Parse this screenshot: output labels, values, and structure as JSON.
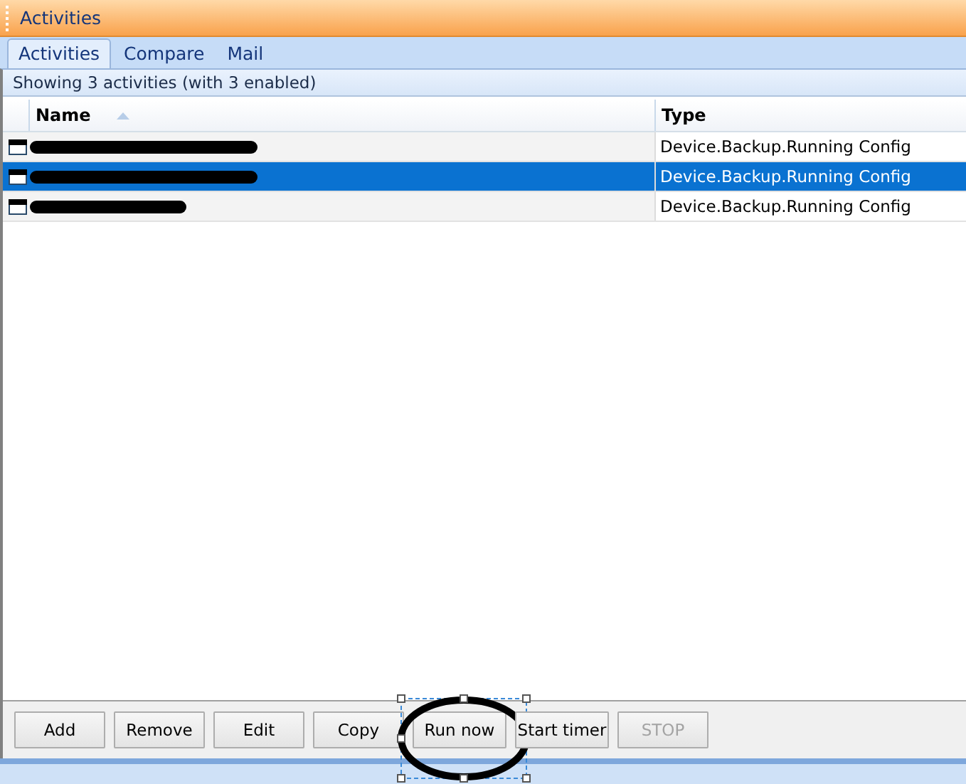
{
  "window": {
    "title": "Activities"
  },
  "tabs": [
    {
      "label": "Activities",
      "selected": true
    },
    {
      "label": "Compare",
      "selected": false
    },
    {
      "label": "Mail",
      "selected": false
    }
  ],
  "summary": "Showing 3 activities (with 3 enabled)",
  "table": {
    "columns": [
      {
        "label": "Name",
        "sorted": true
      },
      {
        "label": "Type",
        "sorted": false
      }
    ],
    "rows": [
      {
        "selected": false,
        "type": "Device.Backup.Running Config"
      },
      {
        "selected": true,
        "type": "Device.Backup.Running Config"
      },
      {
        "selected": false,
        "type": "Device.Backup.Running Config"
      }
    ]
  },
  "buttons": [
    {
      "label": "Add",
      "disabled": false,
      "circled": false
    },
    {
      "label": "Remove",
      "disabled": false,
      "circled": false
    },
    {
      "label": "Edit",
      "disabled": false,
      "circled": false
    },
    {
      "label": "Copy",
      "disabled": false,
      "circled": false
    },
    {
      "label": "Run now",
      "disabled": false,
      "circled": true
    },
    {
      "label": "Start timer",
      "disabled": false,
      "circled": false
    },
    {
      "label": "STOP",
      "disabled": true,
      "circled": false
    }
  ]
}
